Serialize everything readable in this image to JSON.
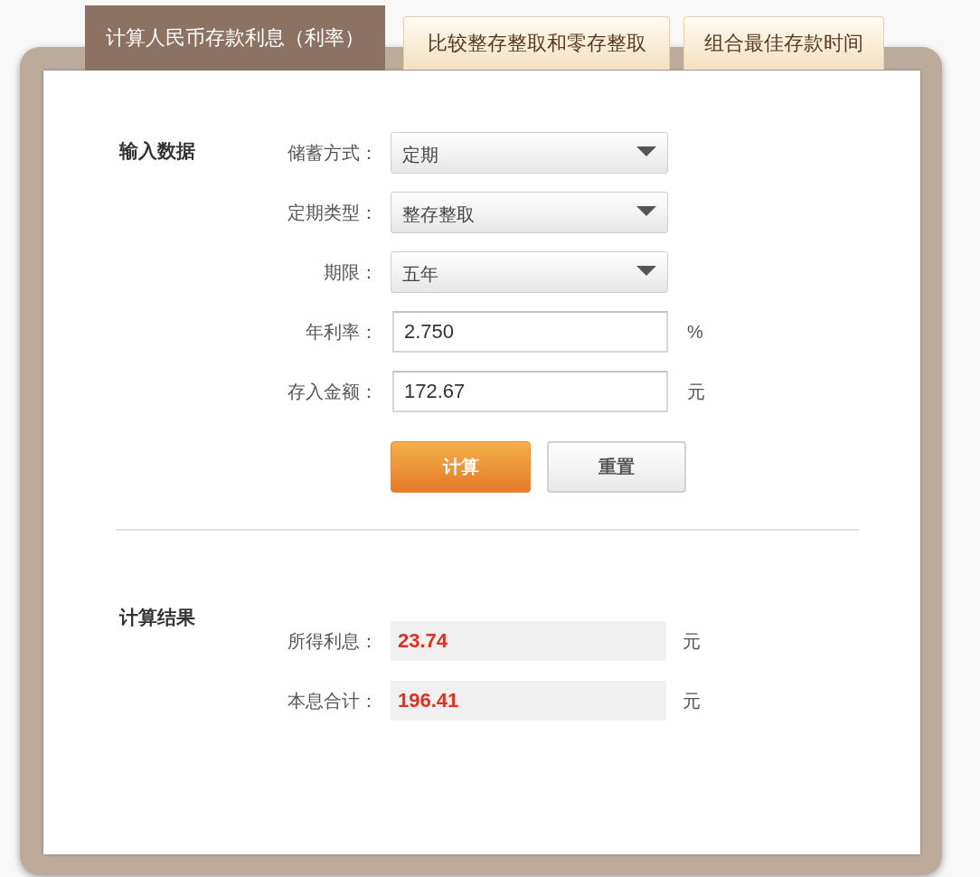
{
  "tabs": [
    {
      "label": "计算人民币存款利息（利率）",
      "selected": true
    },
    {
      "label": "比较整存整取和零存整取",
      "selected": false
    },
    {
      "label": "组合最佳存款时间",
      "selected": false
    }
  ],
  "input_section": {
    "title": "输入数据",
    "fields": [
      {
        "kind": "select",
        "label": "储蓄方式：",
        "value": "定期"
      },
      {
        "kind": "select",
        "label": "定期类型：",
        "value": "整存整取"
      },
      {
        "kind": "select",
        "label": "期限：",
        "value": "五年"
      },
      {
        "kind": "input",
        "label": "年利率：",
        "value": "2.750",
        "unit": "%"
      },
      {
        "kind": "input",
        "label": "存入金额：",
        "value": "172.67",
        "unit": "元"
      }
    ],
    "buttons": [
      {
        "kind": "calculate",
        "label": "计算"
      },
      {
        "kind": "reset",
        "label": "重置"
      }
    ]
  },
  "result_section": {
    "title": "计算结果",
    "rows": [
      {
        "label": "所得利息：",
        "value": "23.74",
        "unit": "元"
      },
      {
        "label": "本息合计：",
        "value": "196.41",
        "unit": "元"
      }
    ]
  }
}
